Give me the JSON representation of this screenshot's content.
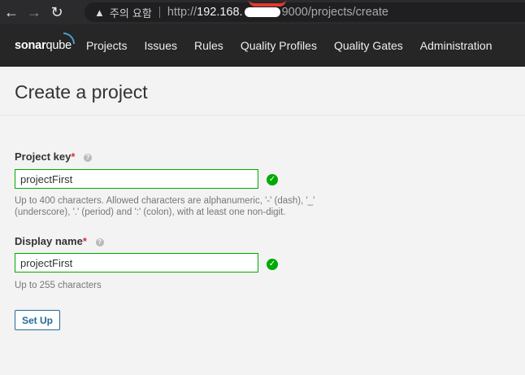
{
  "browser": {
    "security_warning": "주의 요함",
    "url_scheme": "http://",
    "url_host": "192.168.",
    "url_rest": "9000/projects/create"
  },
  "navbar": {
    "logo_bold": "sonar",
    "logo_thin": "qube",
    "items": [
      "Projects",
      "Issues",
      "Rules",
      "Quality Profiles",
      "Quality Gates",
      "Administration"
    ]
  },
  "page": {
    "title": "Create a project"
  },
  "form": {
    "project_key": {
      "label": "Project key",
      "required_mark": "*",
      "value": "projectFirst",
      "description": "Up to 400 characters. Allowed characters are alphanumeric, '-' (dash), '_' (underscore), '.' (period) and ':' (colon), with at least one non-digit."
    },
    "display_name": {
      "label": "Display name",
      "required_mark": "*",
      "value": "projectFirst",
      "description": "Up to 255 characters"
    },
    "submit_label": "Set Up"
  },
  "colors": {
    "valid_border": "#00aa00",
    "button_blue": "#236a97",
    "navbar_bg": "#262626"
  }
}
